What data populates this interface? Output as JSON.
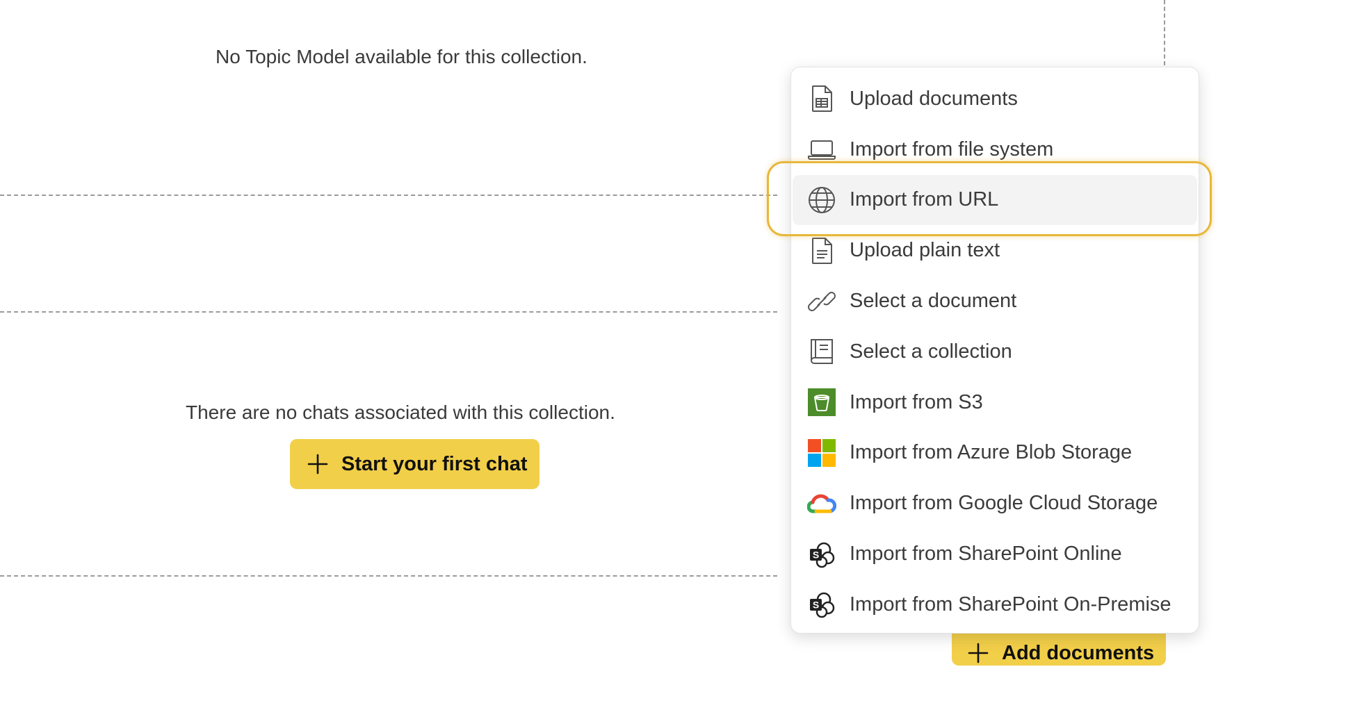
{
  "topic_model": {
    "empty_text": "No Topic Model available for this collection."
  },
  "chats": {
    "empty_text": "There are no chats associated with this collection.",
    "start_button_label": "Start your first chat"
  },
  "documents": {
    "add_button_label": "Add documents"
  },
  "add_menu": {
    "highlighted_item": "Import from URL",
    "items": [
      {
        "label": "Upload documents",
        "icon": "document-table-icon"
      },
      {
        "label": "Import from file system",
        "icon": "laptop-icon"
      },
      {
        "label": "Import from URL",
        "icon": "globe-icon"
      },
      {
        "label": "Upload plain text",
        "icon": "text-document-icon"
      },
      {
        "label": "Select a document",
        "icon": "link-icon"
      },
      {
        "label": "Select a collection",
        "icon": "book-icon"
      },
      {
        "label": "Import from S3",
        "icon": "aws-s3-icon"
      },
      {
        "label": "Import from Azure Blob Storage",
        "icon": "microsoft-icon"
      },
      {
        "label": "Import from Google Cloud Storage",
        "icon": "google-cloud-icon"
      },
      {
        "label": "Import from SharePoint Online",
        "icon": "sharepoint-icon"
      },
      {
        "label": "Import from SharePoint On-Premise",
        "icon": "sharepoint-icon"
      }
    ]
  },
  "colors": {
    "accent_yellow": "#f2cf49",
    "focus_ring": "#e8b73a",
    "s3_green": "#4d8c2a",
    "ms_red": "#f25022",
    "ms_green": "#7fba00",
    "ms_blue": "#00a4ef",
    "ms_yellow": "#ffb900"
  }
}
